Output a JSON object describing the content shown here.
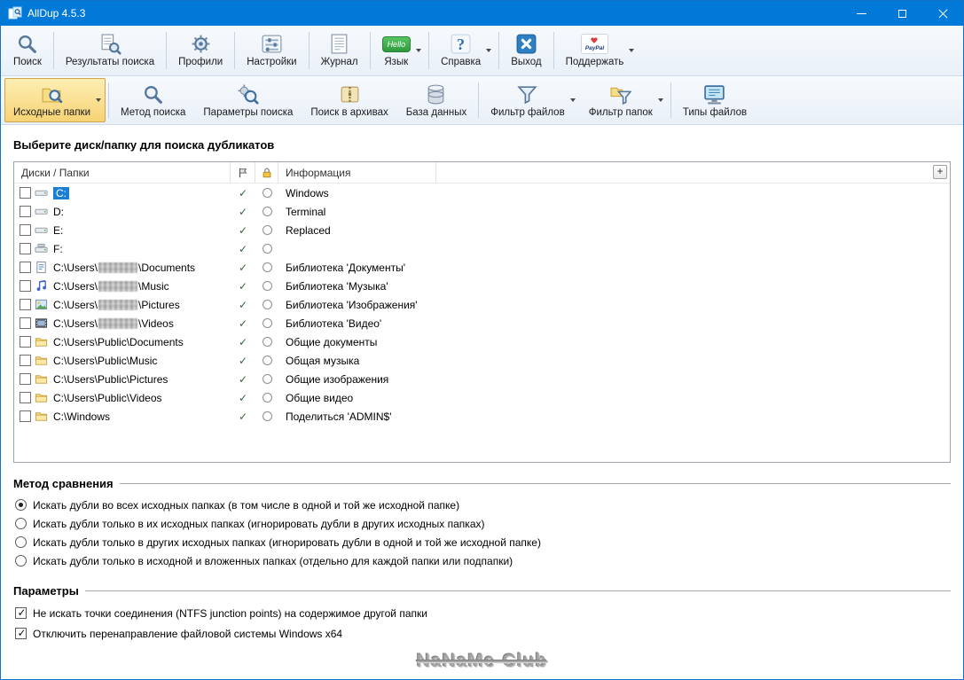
{
  "window": {
    "title": "AllDup 4.5.3"
  },
  "toolbar_main": {
    "items": [
      {
        "label": "Поиск",
        "icon": "search-icon",
        "separator_after": true
      },
      {
        "label": "Результаты поиска",
        "icon": "search-results-icon",
        "separator_after": true
      },
      {
        "label": "Профили",
        "icon": "profiles-icon",
        "separator_after": true
      },
      {
        "label": "Настройки",
        "icon": "settings-icon",
        "separator_after": true
      },
      {
        "label": "Журнал",
        "icon": "journal-icon",
        "separator_after": true
      },
      {
        "label": "Язык",
        "icon": "language-icon",
        "badge": "Hello",
        "dropdown": true,
        "separator_after": true
      },
      {
        "label": "Справка",
        "icon": "help-icon",
        "dropdown": true,
        "separator_after": true
      },
      {
        "label": "Выход",
        "icon": "exit-icon",
        "separator_after": true
      },
      {
        "label": "Поддержать",
        "icon": "paypal-icon",
        "badge": "PayPal",
        "dropdown": true
      }
    ]
  },
  "toolbar_sections": {
    "items": [
      {
        "label": "Исходные папки",
        "icon": "source-folders-icon",
        "selected": true,
        "dropdown": true,
        "separator_after": true
      },
      {
        "label": "Метод поиска",
        "icon": "search-method-icon"
      },
      {
        "label": "Параметры поиска",
        "icon": "search-params-icon"
      },
      {
        "label": "Поиск в архивах",
        "icon": "archives-icon"
      },
      {
        "label": "База данных",
        "icon": "database-icon",
        "separator_after": true
      },
      {
        "label": "Фильтр файлов",
        "icon": "file-filter-icon",
        "dropdown": true
      },
      {
        "label": "Фильтр папок",
        "icon": "folder-filter-icon",
        "dropdown": true,
        "separator_after": true
      },
      {
        "label": "Типы файлов",
        "icon": "file-types-icon"
      }
    ]
  },
  "main": {
    "heading": "Выберите диск/папку для поиска дубликатов",
    "table": {
      "columns": {
        "folders": "Диски / Папки",
        "info": "Информация"
      },
      "add_button": "+",
      "rows": [
        {
          "icon": "drive-icon",
          "path_prefix": "C:",
          "highlight": true,
          "info": "Windows"
        },
        {
          "icon": "drive-icon",
          "path_prefix": "D:",
          "info": "Terminal"
        },
        {
          "icon": "drive-icon",
          "path_prefix": "E:",
          "info": "Replaced"
        },
        {
          "icon": "drive-f-icon",
          "path_prefix": "F:",
          "info": ""
        },
        {
          "icon": "documents-icon",
          "path_prefix": "C:\\Users\\",
          "censored": true,
          "path_suffix": "\\Documents",
          "info": "Библиотека 'Документы'"
        },
        {
          "icon": "music-icon",
          "path_prefix": "C:\\Users\\",
          "censored": true,
          "path_suffix": "\\Music",
          "info": "Библиотека 'Музыка'"
        },
        {
          "icon": "pictures-icon",
          "path_prefix": "C:\\Users\\",
          "censored": true,
          "path_suffix": "\\Pictures",
          "info": "Библиотека 'Изображения'"
        },
        {
          "icon": "videos-icon",
          "path_prefix": "C:\\Users\\",
          "censored": true,
          "path_suffix": "\\Videos",
          "info": "Библиотека 'Видео'"
        },
        {
          "icon": "folder-icon",
          "path_prefix": "C:\\Users\\Public\\Documents",
          "info": "Общие документы"
        },
        {
          "icon": "folder-icon",
          "path_prefix": "C:\\Users\\Public\\Music",
          "info": "Общая музыка"
        },
        {
          "icon": "folder-icon",
          "path_prefix": "C:\\Users\\Public\\Pictures",
          "info": "Общие изображения"
        },
        {
          "icon": "folder-icon",
          "path_prefix": "C:\\Users\\Public\\Videos",
          "info": "Общие видео"
        },
        {
          "icon": "folder-icon",
          "path_prefix": "C:\\Windows",
          "info": "Поделиться 'ADMIN$'"
        }
      ]
    }
  },
  "comparison": {
    "heading": "Метод сравнения",
    "selected_index": 0,
    "options": [
      "Искать дубли во всех исходных папках (в том числе в одной и той же исходной папке)",
      "Искать дубли только в их исходных папках (игнорировать дубли в других исходных папках)",
      "Искать дубли только в других исходных папках (игнорировать дубли в одной и той же исходной папке)",
      "Искать дубли только в исходной и вложенных папках (отдельно для каждой папки или подпапки)"
    ]
  },
  "parameters": {
    "heading": "Параметры",
    "options": [
      {
        "label": "Не искать точки соединения (NTFS junction points) на содержимое другой папки",
        "checked": true
      },
      {
        "label": "Отключить перенаправление файловой системы Windows x64",
        "checked": true
      }
    ]
  },
  "watermark": "NaNaMe-Club"
}
